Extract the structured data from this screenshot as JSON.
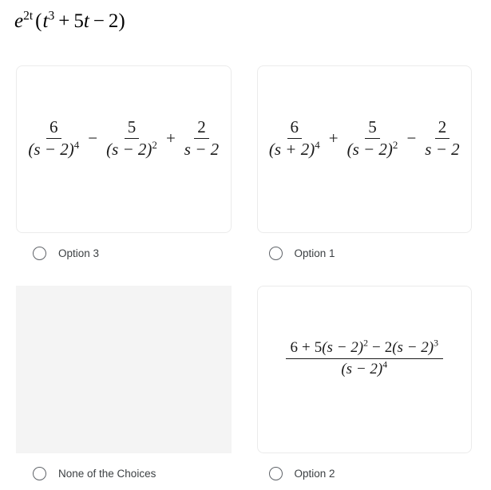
{
  "question": {
    "prompt_plain": "e^(2t) (t^3 + 5t - 2)",
    "base": "e",
    "exponent": "2t",
    "open_paren": "(",
    "term1_var": "t",
    "term1_exp": "3",
    "op1": "+",
    "coef2": "5",
    "term2_var": "t",
    "op2": "−",
    "const": "2",
    "close_paren": ")"
  },
  "choices": [
    {
      "id": "option-3",
      "label": "Option 3",
      "selected": false,
      "card_type": "formula",
      "formula_plain": "6/(s-2)^4 - 5/(s-2)^2 + 2/(s-2)",
      "terms": [
        {
          "num": "6",
          "den_base": "(s − 2)",
          "den_exp": "4",
          "op_before": ""
        },
        {
          "num": "5",
          "den_base": "(s − 2)",
          "den_exp": "2",
          "op_before": "−"
        },
        {
          "num": "2",
          "den_base": "s − 2",
          "den_exp": "",
          "op_before": "+"
        }
      ]
    },
    {
      "id": "option-1",
      "label": "Option 1",
      "selected": false,
      "card_type": "formula",
      "formula_plain": "6/(s+2)^4 + 5/(s-2)^2 - 2/(s-2)",
      "terms": [
        {
          "num": "6",
          "den_base": "(s + 2)",
          "den_exp": "4",
          "op_before": ""
        },
        {
          "num": "5",
          "den_base": "(s − 2)",
          "den_exp": "2",
          "op_before": "+"
        },
        {
          "num": "2",
          "den_base": "s − 2",
          "den_exp": "",
          "op_before": "−"
        }
      ]
    },
    {
      "id": "none-of-the-choices",
      "label": "None of the Choices",
      "selected": false,
      "card_type": "placeholder",
      "formula_plain": ""
    },
    {
      "id": "option-2",
      "label": "Option 2",
      "selected": false,
      "card_type": "single-fraction",
      "formula_plain": "(6 + 5(s-2)^2 - 2(s-2)^3)/(s-2)^4",
      "numerator": {
        "t1": "6",
        "op1": "+",
        "t2_coef": "5",
        "t2_base": "(s − 2)",
        "t2_exp": "2",
        "op2": "−",
        "t3_coef": "2",
        "t3_base": "(s − 2)",
        "t3_exp": "3"
      },
      "denominator": {
        "base": "(s − 2)",
        "exp": "4"
      }
    }
  ],
  "colors": {
    "card_border": "#ebebeb",
    "placeholder_fill": "#f4f4f4",
    "label_text": "#3c4043",
    "radio_stroke": "#5f6368",
    "math_text": "#1a1a1a",
    "page_background": "#ffffff"
  }
}
